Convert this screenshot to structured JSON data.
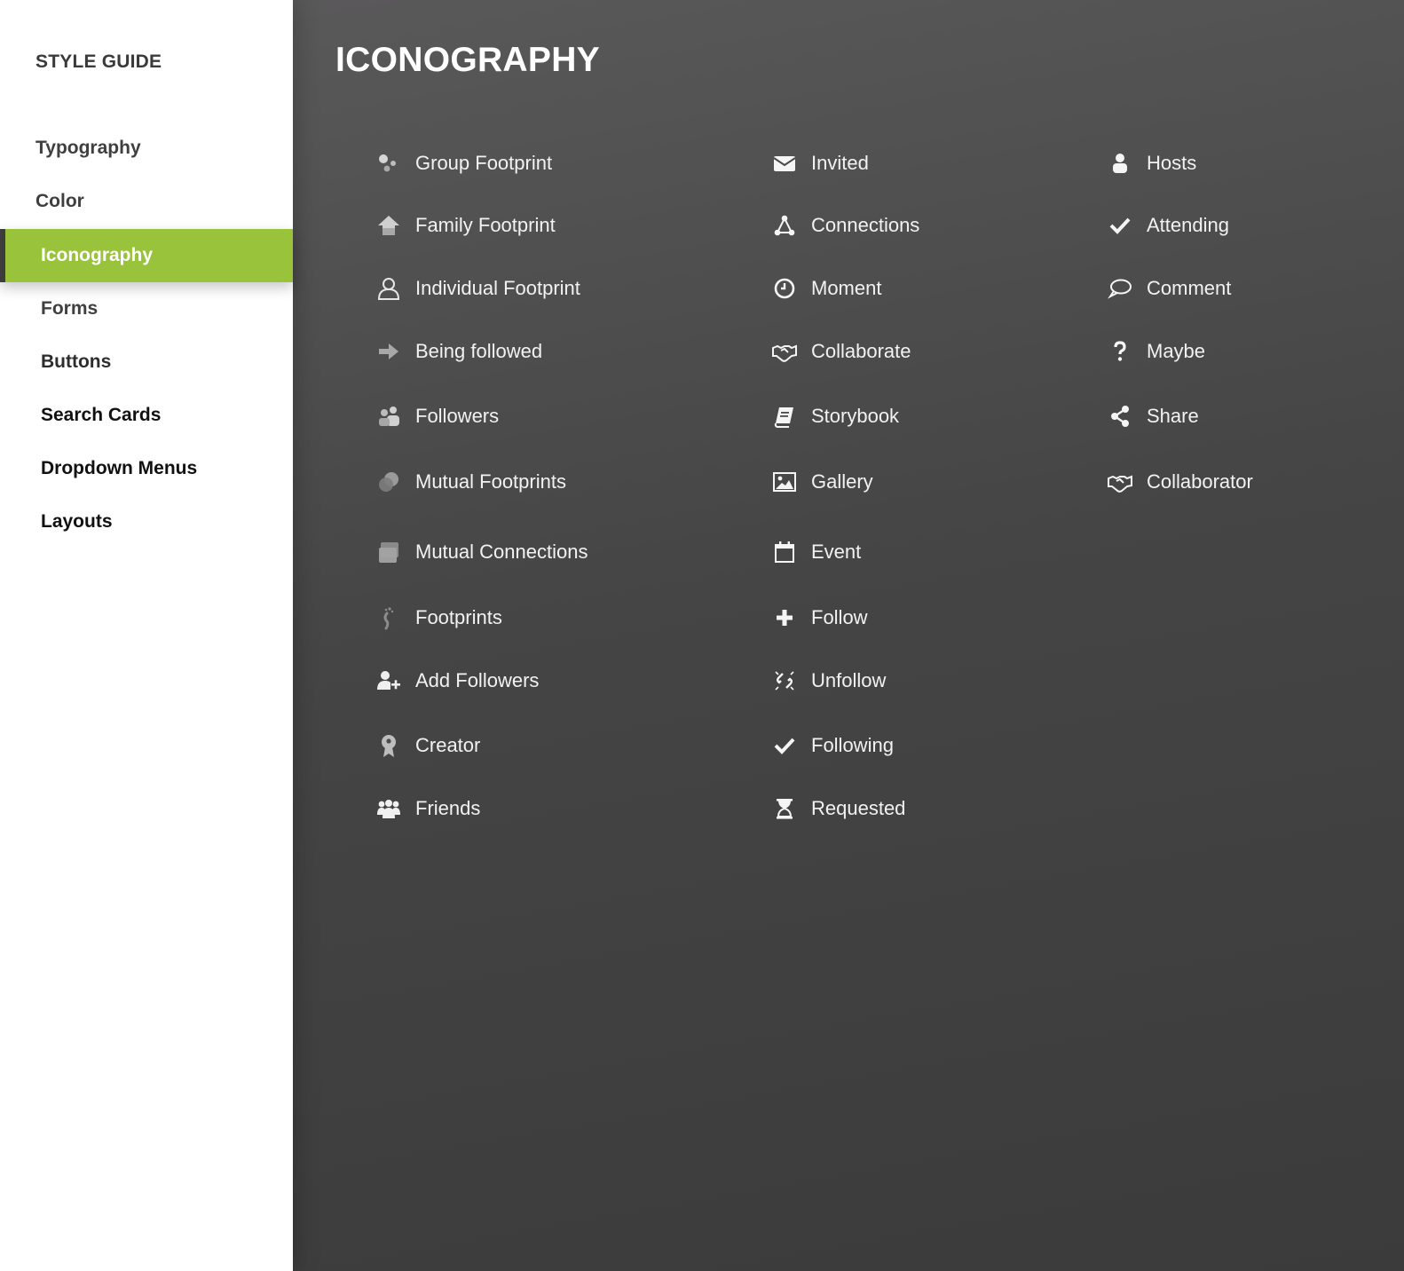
{
  "sidebar": {
    "brand": "STYLE GUIDE",
    "items": [
      {
        "label": "Typography",
        "active": false
      },
      {
        "label": "Color",
        "active": false
      },
      {
        "label": "Iconography",
        "active": true
      },
      {
        "label": "Forms",
        "active": false
      },
      {
        "label": "Buttons",
        "active": false
      },
      {
        "label": "Search Cards",
        "active": false
      },
      {
        "label": "Dropdown Menus",
        "active": false
      },
      {
        "label": "Layouts",
        "active": false
      }
    ]
  },
  "main": {
    "title": "ICONOGRAPHY",
    "columns": [
      [
        {
          "label": "Group Footprint",
          "icon": "group-footprint-icon"
        },
        {
          "label": "Family Footprint",
          "icon": "family-footprint-icon"
        },
        {
          "label": "Individual Footprint",
          "icon": "individual-footprint-icon"
        },
        {
          "label": "Being followed",
          "icon": "being-followed-icon"
        },
        {
          "label": "Followers",
          "icon": "followers-icon"
        },
        {
          "label": "Mutual Footprints",
          "icon": "mutual-footprints-icon"
        },
        {
          "label": "Mutual Connections",
          "icon": "mutual-connections-icon"
        },
        {
          "label": "Footprints",
          "icon": "footprints-icon"
        },
        {
          "label": "Add Followers",
          "icon": "add-followers-icon"
        },
        {
          "label": "Creator",
          "icon": "creator-icon"
        },
        {
          "label": "Friends",
          "icon": "friends-icon"
        }
      ],
      [
        {
          "label": "Invited",
          "icon": "invited-icon"
        },
        {
          "label": "Connections",
          "icon": "connections-icon"
        },
        {
          "label": "Moment",
          "icon": "moment-icon"
        },
        {
          "label": "Collaborate",
          "icon": "collaborate-icon"
        },
        {
          "label": "Storybook",
          "icon": "storybook-icon"
        },
        {
          "label": "Gallery",
          "icon": "gallery-icon"
        },
        {
          "label": "Event",
          "icon": "event-icon"
        },
        {
          "label": "Follow",
          "icon": "follow-icon"
        },
        {
          "label": "Unfollow",
          "icon": "unfollow-icon"
        },
        {
          "label": "Following",
          "icon": "following-icon"
        },
        {
          "label": "Requested",
          "icon": "requested-icon"
        }
      ],
      [
        {
          "label": "Hosts",
          "icon": "hosts-icon"
        },
        {
          "label": "Attending",
          "icon": "attending-icon"
        },
        {
          "label": "Comment",
          "icon": "comment-icon"
        },
        {
          "label": "Maybe",
          "icon": "maybe-icon"
        },
        {
          "label": "Share",
          "icon": "share-icon"
        },
        {
          "label": "Collaborator",
          "icon": "collaborator-icon"
        }
      ]
    ]
  },
  "colors": {
    "accent": "#98c33b",
    "sidebar_bg": "#ffffff",
    "main_bg": "#454545",
    "active_border": "#3d3d3d"
  }
}
